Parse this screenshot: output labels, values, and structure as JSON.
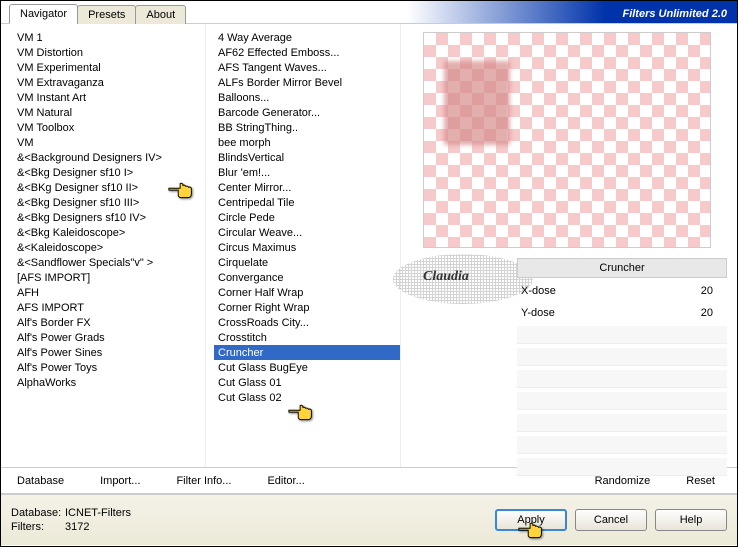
{
  "app": {
    "title": "Filters Unlimited 2.0"
  },
  "tabs": [
    {
      "id": "navigator",
      "label": "Navigator",
      "active": true
    },
    {
      "id": "presets",
      "label": "Presets",
      "active": false
    },
    {
      "id": "about",
      "label": "About",
      "active": false
    }
  ],
  "categories": [
    "VM 1",
    "VM Distortion",
    "VM Experimental",
    "VM Extravaganza",
    "VM Instant Art",
    "VM Natural",
    "VM Toolbox",
    "VM",
    "&<Background Designers IV>",
    "&<Bkg Designer sf10 I>",
    "&<BKg Designer sf10 II>",
    "&<Bkg Designer sf10 III>",
    "&<Bkg Designers sf10 IV>",
    "&<Bkg Kaleidoscope>",
    "&<Kaleidoscope>",
    "&<Sandflower Specials\"v\" >",
    "[AFS IMPORT]",
    "AFH",
    "AFS IMPORT",
    "Alf's Border FX",
    "Alf's Power Grads",
    "Alf's Power Sines",
    "Alf's Power Toys",
    "AlphaWorks"
  ],
  "categories_selected_index": -1,
  "filters": [
    "4 Way Average",
    "AF62 Effected Emboss...",
    "AFS Tangent Waves...",
    "ALFs Border Mirror Bevel",
    "Balloons...",
    "Barcode Generator...",
    "BB StringThing..",
    "bee morph",
    "BlindsVertical",
    "Blur 'em!...",
    "Center Mirror...",
    "Centripedal Tile",
    "Circle Pede",
    "Circular Weave...",
    "Circus Maximus",
    "Cirquelate",
    "Convergance",
    "Corner Half Wrap",
    "Corner Right Wrap",
    "CrossRoads City...",
    "Crosstitch",
    "Cruncher",
    "Cut Glass  BugEye",
    "Cut Glass 01",
    "Cut Glass 02"
  ],
  "filters_selected_index": 21,
  "current_filter_label": "Cruncher",
  "params": [
    {
      "name": "X-dose",
      "value": 20
    },
    {
      "name": "Y-dose",
      "value": 20
    }
  ],
  "toolbar": {
    "database": "Database",
    "import": "Import...",
    "filter_info": "Filter Info...",
    "editor": "Editor...",
    "randomize": "Randomize",
    "reset": "Reset"
  },
  "footer": {
    "database_label": "Database:",
    "database_value": "ICNET-Filters",
    "filters_label": "Filters:",
    "filters_value": "3172",
    "apply": "Apply",
    "cancel": "Cancel",
    "help": "Help"
  },
  "stamp_text": "Claudia"
}
